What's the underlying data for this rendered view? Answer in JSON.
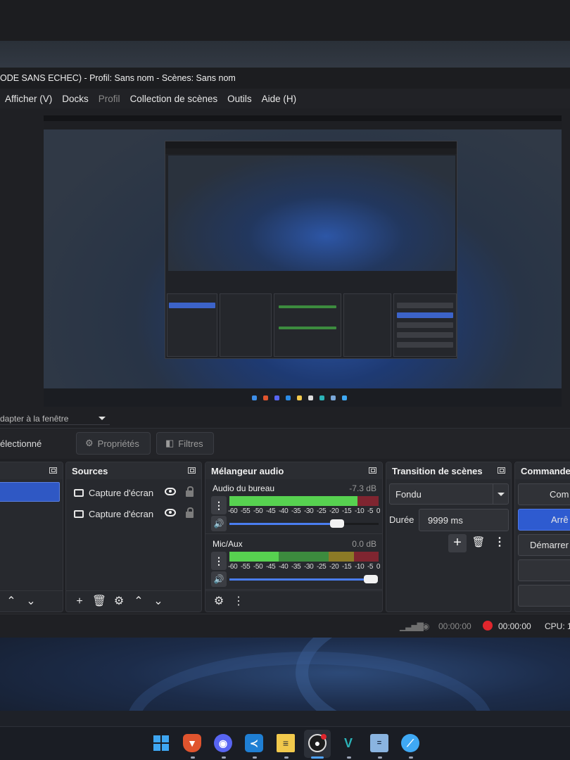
{
  "window": {
    "title": "ODE SANS ECHEC) - Profil: Sans nom - Scènes: Sans nom"
  },
  "menu": {
    "items": [
      "Afficher (V)",
      "Docks",
      "Profil",
      "Collection de scènes",
      "Outils",
      "Aide (H)"
    ]
  },
  "preview": {
    "scale_label": "dapter à la fenêtre"
  },
  "context_bar": {
    "text": "électionné",
    "properties_label": "Propriétés",
    "filters_label": "Filtres"
  },
  "docks": {
    "sources": {
      "title": "Sources",
      "items": [
        {
          "label": "Capture d'écran"
        },
        {
          "label": "Capture d'écran"
        }
      ]
    },
    "mixer": {
      "title": "Mélangeur audio",
      "channels": [
        {
          "name": "Audio du bureau",
          "db": "-7.3 dB",
          "volume": 0.72,
          "level": 0.86
        },
        {
          "name": "Mic/Aux",
          "db": "0.0 dB",
          "volume": 0.95,
          "level": 0.33
        }
      ],
      "ticks": [
        "-60",
        "-55",
        "-50",
        "-45",
        "-40",
        "-35",
        "-30",
        "-25",
        "-20",
        "-15",
        "-10",
        "-5",
        "0"
      ]
    },
    "transitions": {
      "title": "Transition de scènes",
      "selected": "Fondu",
      "duration_label": "Durée",
      "duration_value": "9999 ms"
    },
    "controls": {
      "title": "Commande",
      "buttons": [
        "Com",
        "Arrê",
        "Démarrer",
        "",
        ""
      ]
    }
  },
  "status": {
    "rec_time_1": "00:00:00",
    "rec_time_2": "00:00:00",
    "cpu": "CPU: 1"
  },
  "taskbar": {
    "icons": [
      "windows-start-icon",
      "brave-icon",
      "discord-icon",
      "vscode-icon",
      "notepad-icon",
      "obs-icon",
      "visual-studio-icon",
      "calculator-icon",
      "browser-icon"
    ]
  }
}
